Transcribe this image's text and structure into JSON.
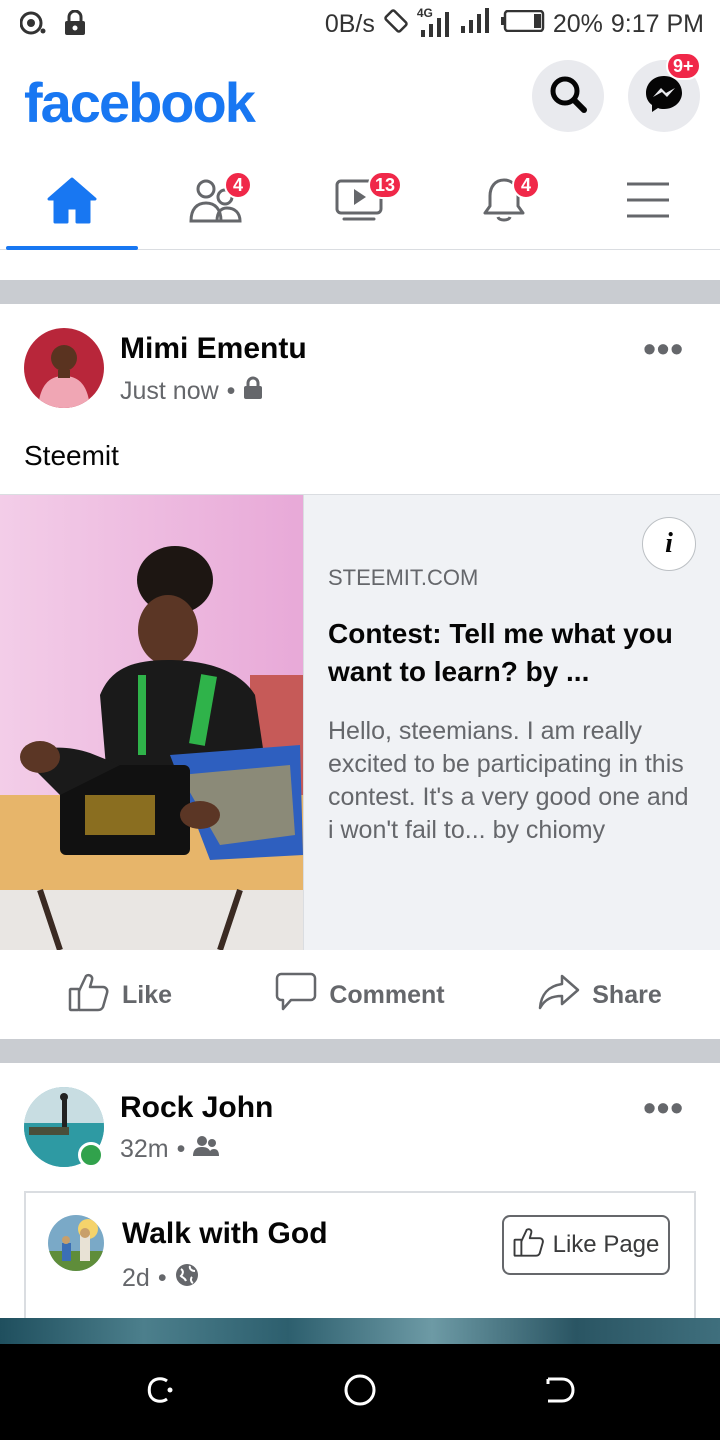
{
  "status_bar": {
    "speed": "0B/s",
    "network": "4G",
    "battery": "20%",
    "time": "9:17 PM"
  },
  "header": {
    "logo": "facebook",
    "messenger_badge": "9+"
  },
  "tabs": [
    {
      "name": "home",
      "badge": ""
    },
    {
      "name": "friends",
      "badge": "4"
    },
    {
      "name": "watch",
      "badge": "13"
    },
    {
      "name": "notifications",
      "badge": "4"
    },
    {
      "name": "menu",
      "badge": ""
    }
  ],
  "post1": {
    "author": "Mimi Ementu",
    "time": "Just now",
    "text": "Steemit",
    "link": {
      "domain": "STEEMIT.COM",
      "title": "Contest: Tell me what you want to learn? by ...",
      "description": "Hello, steemians. I am really excited to be participating in this contest. It's a very good one and i won't fail to... by chiomy"
    }
  },
  "actions": {
    "like": "Like",
    "comment": "Comment",
    "share": "Share"
  },
  "post2": {
    "author": "Rock John",
    "time": "32m",
    "shared": {
      "page_name": "Walk with God",
      "time": "2d",
      "like_page": "Like Page"
    }
  },
  "colors": {
    "brand": "#1877f2",
    "badge": "#f02849",
    "online": "#31a24c"
  }
}
